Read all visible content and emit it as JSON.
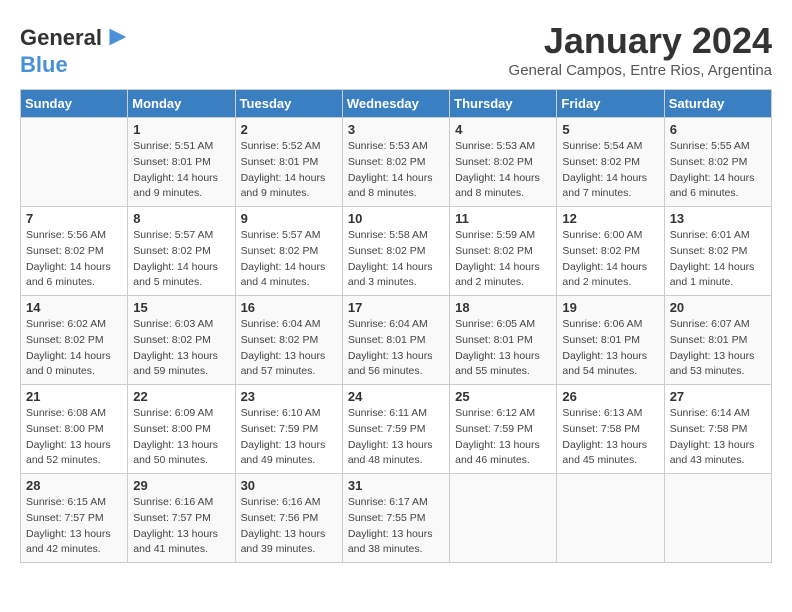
{
  "header": {
    "logo_general": "General",
    "logo_blue": "Blue",
    "month": "January 2024",
    "location": "General Campos, Entre Rios, Argentina"
  },
  "days_of_week": [
    "Sunday",
    "Monday",
    "Tuesday",
    "Wednesday",
    "Thursday",
    "Friday",
    "Saturday"
  ],
  "weeks": [
    [
      {
        "day": "",
        "info": ""
      },
      {
        "day": "1",
        "info": "Sunrise: 5:51 AM\nSunset: 8:01 PM\nDaylight: 14 hours\nand 9 minutes."
      },
      {
        "day": "2",
        "info": "Sunrise: 5:52 AM\nSunset: 8:01 PM\nDaylight: 14 hours\nand 9 minutes."
      },
      {
        "day": "3",
        "info": "Sunrise: 5:53 AM\nSunset: 8:02 PM\nDaylight: 14 hours\nand 8 minutes."
      },
      {
        "day": "4",
        "info": "Sunrise: 5:53 AM\nSunset: 8:02 PM\nDaylight: 14 hours\nand 8 minutes."
      },
      {
        "day": "5",
        "info": "Sunrise: 5:54 AM\nSunset: 8:02 PM\nDaylight: 14 hours\nand 7 minutes."
      },
      {
        "day": "6",
        "info": "Sunrise: 5:55 AM\nSunset: 8:02 PM\nDaylight: 14 hours\nand 6 minutes."
      }
    ],
    [
      {
        "day": "7",
        "info": "Sunrise: 5:56 AM\nSunset: 8:02 PM\nDaylight: 14 hours\nand 6 minutes."
      },
      {
        "day": "8",
        "info": "Sunrise: 5:57 AM\nSunset: 8:02 PM\nDaylight: 14 hours\nand 5 minutes."
      },
      {
        "day": "9",
        "info": "Sunrise: 5:57 AM\nSunset: 8:02 PM\nDaylight: 14 hours\nand 4 minutes."
      },
      {
        "day": "10",
        "info": "Sunrise: 5:58 AM\nSunset: 8:02 PM\nDaylight: 14 hours\nand 3 minutes."
      },
      {
        "day": "11",
        "info": "Sunrise: 5:59 AM\nSunset: 8:02 PM\nDaylight: 14 hours\nand 2 minutes."
      },
      {
        "day": "12",
        "info": "Sunrise: 6:00 AM\nSunset: 8:02 PM\nDaylight: 14 hours\nand 2 minutes."
      },
      {
        "day": "13",
        "info": "Sunrise: 6:01 AM\nSunset: 8:02 PM\nDaylight: 14 hours\nand 1 minute."
      }
    ],
    [
      {
        "day": "14",
        "info": "Sunrise: 6:02 AM\nSunset: 8:02 PM\nDaylight: 14 hours\nand 0 minutes."
      },
      {
        "day": "15",
        "info": "Sunrise: 6:03 AM\nSunset: 8:02 PM\nDaylight: 13 hours\nand 59 minutes."
      },
      {
        "day": "16",
        "info": "Sunrise: 6:04 AM\nSunset: 8:02 PM\nDaylight: 13 hours\nand 57 minutes."
      },
      {
        "day": "17",
        "info": "Sunrise: 6:04 AM\nSunset: 8:01 PM\nDaylight: 13 hours\nand 56 minutes."
      },
      {
        "day": "18",
        "info": "Sunrise: 6:05 AM\nSunset: 8:01 PM\nDaylight: 13 hours\nand 55 minutes."
      },
      {
        "day": "19",
        "info": "Sunrise: 6:06 AM\nSunset: 8:01 PM\nDaylight: 13 hours\nand 54 minutes."
      },
      {
        "day": "20",
        "info": "Sunrise: 6:07 AM\nSunset: 8:01 PM\nDaylight: 13 hours\nand 53 minutes."
      }
    ],
    [
      {
        "day": "21",
        "info": "Sunrise: 6:08 AM\nSunset: 8:00 PM\nDaylight: 13 hours\nand 52 minutes."
      },
      {
        "day": "22",
        "info": "Sunrise: 6:09 AM\nSunset: 8:00 PM\nDaylight: 13 hours\nand 50 minutes."
      },
      {
        "day": "23",
        "info": "Sunrise: 6:10 AM\nSunset: 7:59 PM\nDaylight: 13 hours\nand 49 minutes."
      },
      {
        "day": "24",
        "info": "Sunrise: 6:11 AM\nSunset: 7:59 PM\nDaylight: 13 hours\nand 48 minutes."
      },
      {
        "day": "25",
        "info": "Sunrise: 6:12 AM\nSunset: 7:59 PM\nDaylight: 13 hours\nand 46 minutes."
      },
      {
        "day": "26",
        "info": "Sunrise: 6:13 AM\nSunset: 7:58 PM\nDaylight: 13 hours\nand 45 minutes."
      },
      {
        "day": "27",
        "info": "Sunrise: 6:14 AM\nSunset: 7:58 PM\nDaylight: 13 hours\nand 43 minutes."
      }
    ],
    [
      {
        "day": "28",
        "info": "Sunrise: 6:15 AM\nSunset: 7:57 PM\nDaylight: 13 hours\nand 42 minutes."
      },
      {
        "day": "29",
        "info": "Sunrise: 6:16 AM\nSunset: 7:57 PM\nDaylight: 13 hours\nand 41 minutes."
      },
      {
        "day": "30",
        "info": "Sunrise: 6:16 AM\nSunset: 7:56 PM\nDaylight: 13 hours\nand 39 minutes."
      },
      {
        "day": "31",
        "info": "Sunrise: 6:17 AM\nSunset: 7:55 PM\nDaylight: 13 hours\nand 38 minutes."
      },
      {
        "day": "",
        "info": ""
      },
      {
        "day": "",
        "info": ""
      },
      {
        "day": "",
        "info": ""
      }
    ]
  ]
}
